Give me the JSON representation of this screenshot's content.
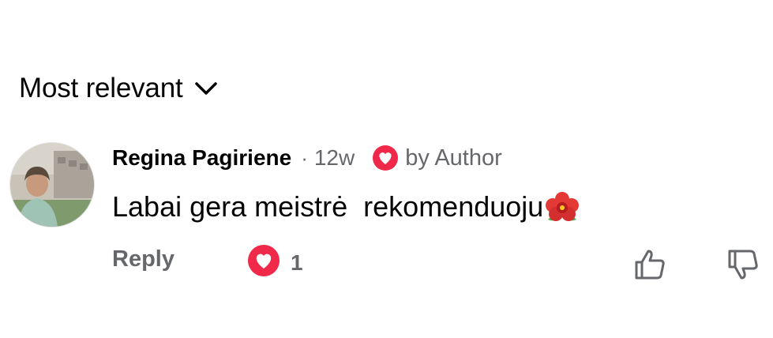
{
  "sort": {
    "label": "Most relevant",
    "icon": "chevron-down-icon"
  },
  "comment": {
    "author": "Regina Pagiriene",
    "separator": "·",
    "time": "12w",
    "badge_icon": "heart-icon",
    "badge_text": "by Author",
    "text": "Labai gera meistrė  rekomenduoju",
    "emoji_icon": "hibiscus-icon",
    "reply_label": "Reply",
    "reaction_icon": "heart-reaction-icon",
    "reaction_count": "1",
    "like_icon": "thumbs-up-icon",
    "dislike_icon": "thumbs-down-icon"
  },
  "colors": {
    "heart": "#f02849",
    "secondary_text": "#65676b",
    "primary_text": "#050505"
  }
}
